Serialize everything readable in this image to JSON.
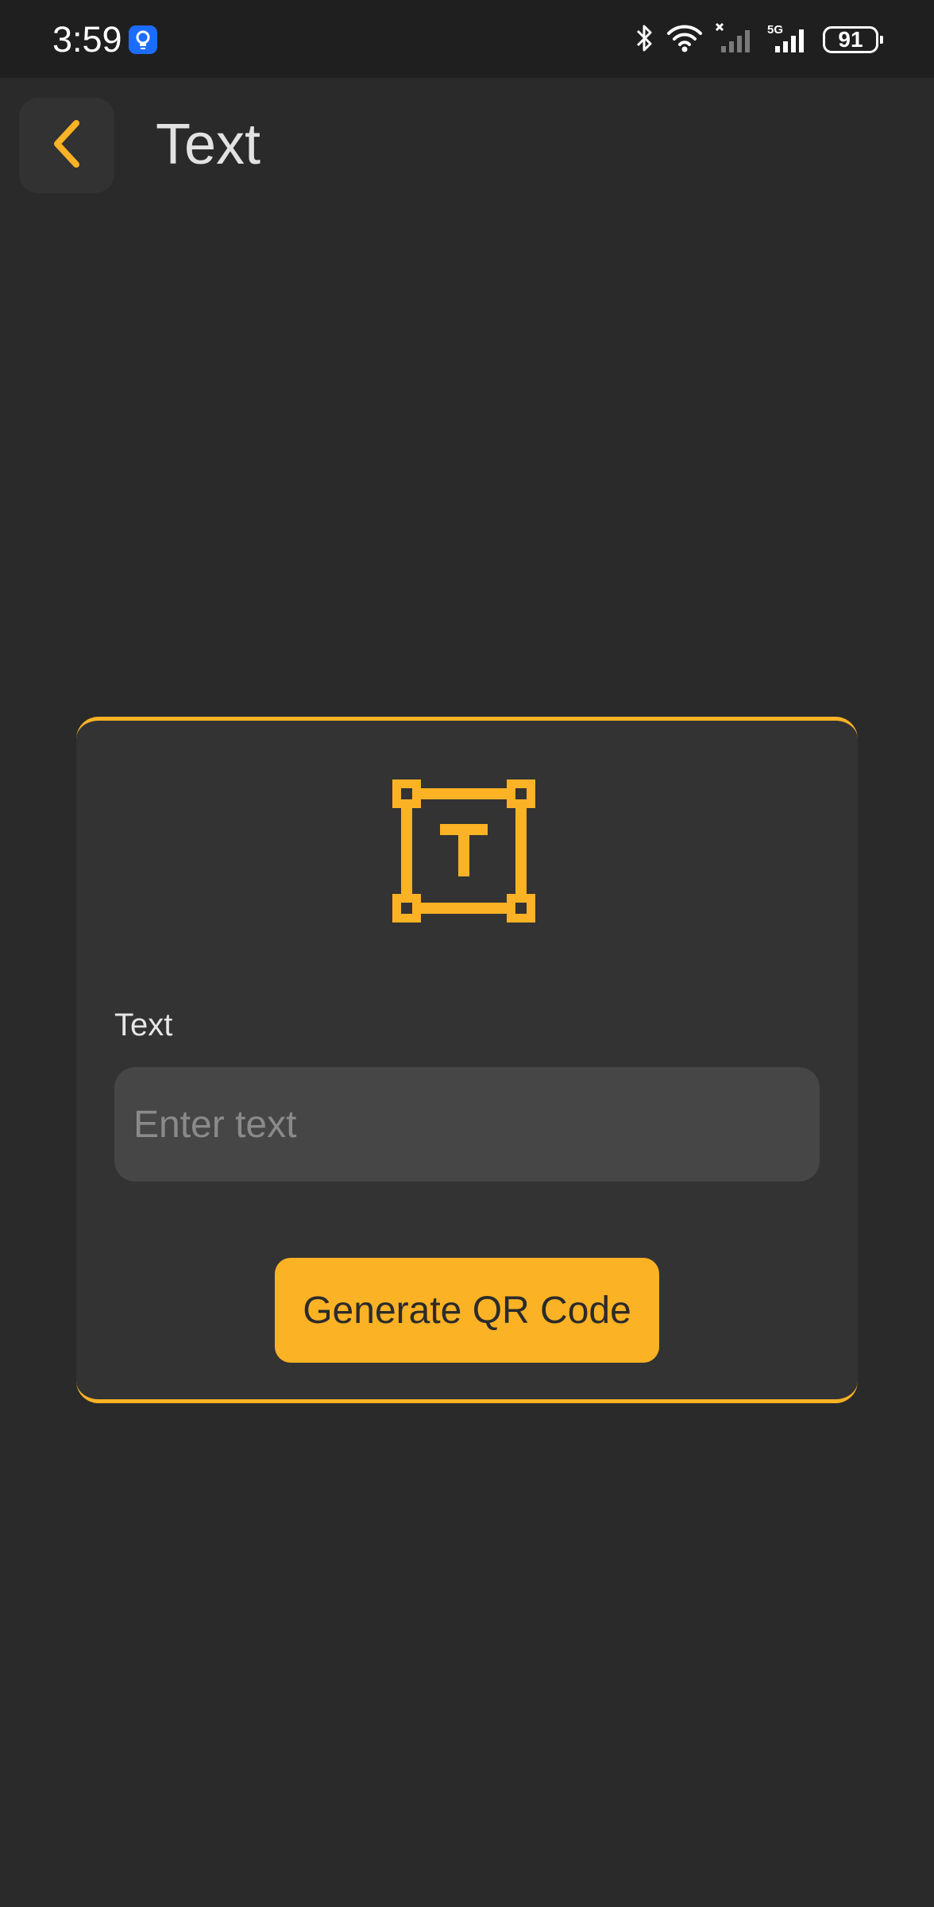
{
  "status_bar": {
    "time": "3:59",
    "battery": "91",
    "network": "5G",
    "icons": [
      "notification-bulb-icon",
      "bluetooth-icon",
      "wifi-icon",
      "signal-no-service-icon",
      "signal-5g-icon",
      "battery-icon"
    ]
  },
  "header": {
    "title": "Text",
    "back_icon": "chevron-left-icon"
  },
  "card": {
    "icon": "text-frame-icon",
    "field_label": "Text",
    "input": {
      "value": "",
      "placeholder": "Enter text"
    },
    "button_label": "Generate QR Code"
  },
  "colors": {
    "accent": "#fbb224",
    "background": "#2a2a2a",
    "card": "#333333",
    "input": "#464646"
  }
}
